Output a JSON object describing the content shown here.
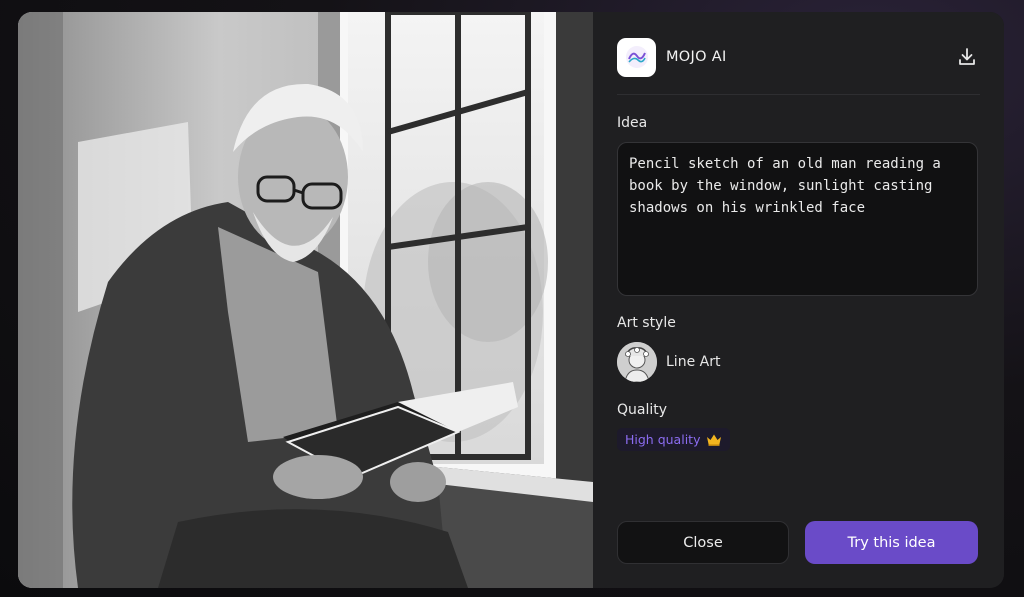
{
  "header": {
    "app_name": "MOJO AI",
    "logo_icon": "mojo-logo-icon",
    "download_icon": "download-icon"
  },
  "idea": {
    "label": "Idea",
    "text": "Pencil sketch of an old man reading a book by the window, sunlight casting shadows on his wrinkled face"
  },
  "art_style": {
    "label": "Art style",
    "name": "Line Art",
    "thumb_icon": "line-art-thumbnail"
  },
  "quality": {
    "label": "Quality",
    "badge": "High quality",
    "badge_icon": "crown-icon",
    "badge_color": "#8b6cf0"
  },
  "actions": {
    "close_label": "Close",
    "try_label": "Try this idea",
    "accent": "#6a4bc8"
  }
}
